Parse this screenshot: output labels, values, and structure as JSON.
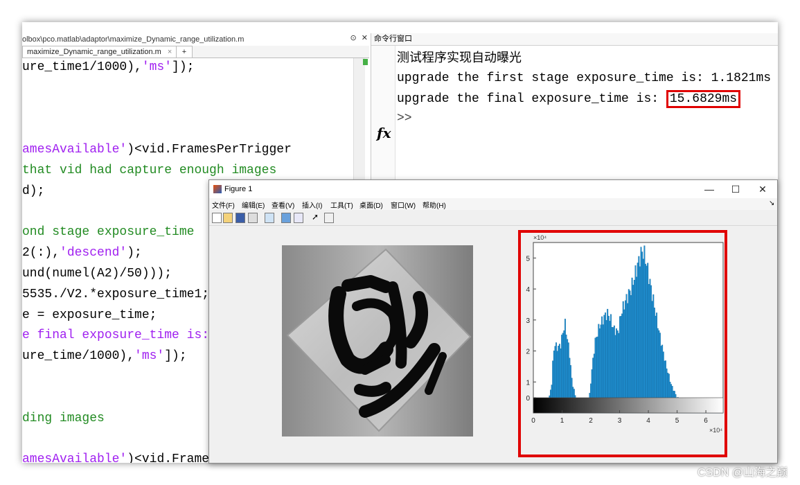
{
  "editor": {
    "path": "olbox\\pco.matlab\\adaptor\\maximize_Dynamic_range_utilization.m",
    "tab_label": "maximize_Dynamic_range_utilization.m",
    "tab_close": "×",
    "tab_add": "+",
    "ctrl_expand": "⊙",
    "ctrl_close": "✕",
    "lines": [
      {
        "parts": [
          {
            "t": "ure_time1/1000),",
            "c": "n"
          },
          {
            "t": "'ms'",
            "c": "s"
          },
          {
            "t": "]);",
            "c": "n"
          }
        ]
      },
      {
        "parts": []
      },
      {
        "parts": []
      },
      {
        "parts": []
      },
      {
        "parts": [
          {
            "t": "amesAvailable'",
            "c": "s"
          },
          {
            "t": ")<vid.FramesPerTrigger",
            "c": "n"
          }
        ]
      },
      {
        "parts": [
          {
            "t": "that vid had capture enough images",
            "c": "g"
          }
        ]
      },
      {
        "parts": [
          {
            "t": "d);",
            "c": "n"
          }
        ]
      },
      {
        "parts": []
      },
      {
        "parts": [
          {
            "t": "ond stage exposure_time",
            "c": "g"
          }
        ]
      },
      {
        "parts": [
          {
            "t": "2(:),",
            "c": "n"
          },
          {
            "t": "'descend'",
            "c": "s"
          },
          {
            "t": ");",
            "c": "n"
          }
        ]
      },
      {
        "parts": [
          {
            "t": "und(numel(A2)/50)));",
            "c": "n"
          }
        ]
      },
      {
        "parts": [
          {
            "t": "5535./V2.*exposure_time1;",
            "c": "n"
          }
        ]
      },
      {
        "parts": [
          {
            "t": "e = exposure_time;",
            "c": "n"
          }
        ]
      },
      {
        "parts": [
          {
            "t": "e final exposure_time is: '",
            "c": "s"
          },
          {
            "t": ",",
            "c": "n"
          }
        ]
      },
      {
        "parts": [
          {
            "t": "ure_time/1000),",
            "c": "n"
          },
          {
            "t": "'ms'",
            "c": "s"
          },
          {
            "t": "]);",
            "c": "n"
          }
        ]
      },
      {
        "parts": []
      },
      {
        "parts": []
      },
      {
        "parts": [
          {
            "t": "ding images",
            "c": "g"
          }
        ]
      },
      {
        "parts": []
      },
      {
        "parts": [
          {
            "t": "amesAvailable'",
            "c": "s"
          },
          {
            "t": ")<vid.FramesPerTrigger",
            "c": "n"
          }
        ]
      }
    ]
  },
  "command_window": {
    "title": "命令行窗口",
    "line1": "测试程序实现自动曝光",
    "line2": "upgrade the first stage exposure_time is: 1.1821ms",
    "line3_prefix": "upgrade the final exposure_time is: ",
    "line3_value": "15.6829ms",
    "prompt": ">>",
    "fx": "fx"
  },
  "figure": {
    "title": "Figure 1",
    "minimize": "—",
    "maximize": "☐",
    "close": "✕",
    "menu": [
      "文件(F)",
      "编辑(E)",
      "查看(V)",
      "插入(I)",
      "工具(T)",
      "桌面(D)",
      "窗口(W)",
      "帮助(H)"
    ],
    "menu_arrow": "↘"
  },
  "chart_data": {
    "type": "bar",
    "title": "",
    "xlabel": "",
    "ylabel": "",
    "y_exponent_label": "×10⁴",
    "x_exponent_label": "×10⁴",
    "ylim": [
      0,
      5.5
    ],
    "xlim": [
      0,
      6.6
    ],
    "yticks": [
      "0",
      "1",
      "2",
      "3",
      "4",
      "5"
    ],
    "xticks": [
      "0",
      "1",
      "2",
      "3",
      "4",
      "5",
      "6"
    ],
    "color": "#1f8fd0",
    "profile": {
      "x": [
        0.35,
        0.5,
        0.65,
        0.7,
        0.75,
        0.85,
        0.95,
        1.05,
        1.1,
        1.15,
        1.25,
        1.35,
        1.5,
        1.65,
        1.8,
        1.95,
        2.05,
        2.15,
        2.3,
        2.5,
        2.6,
        2.7,
        2.8,
        2.95,
        3.05,
        3.2,
        3.4,
        3.55,
        3.7,
        3.8,
        3.9,
        4.0,
        4.2,
        4.4,
        4.6,
        4.8,
        5.0,
        5.3,
        5.6,
        6.0,
        6.4,
        6.55
      ],
      "y": [
        0.05,
        0.2,
        1.0,
        2.0,
        2.2,
        2.1,
        2.2,
        2.7,
        2.9,
        2.6,
        2.0,
        1.0,
        0.4,
        0.2,
        0.15,
        0.5,
        1.5,
        2.3,
        2.8,
        3.15,
        3.2,
        3.0,
        2.7,
        2.6,
        3.2,
        3.6,
        4.0,
        4.5,
        5.0,
        5.25,
        5.0,
        4.5,
        3.5,
        2.5,
        1.6,
        0.9,
        0.5,
        0.25,
        0.12,
        0.06,
        0.05,
        0.0
      ]
    }
  },
  "watermark": "CSDN @山海之巅"
}
